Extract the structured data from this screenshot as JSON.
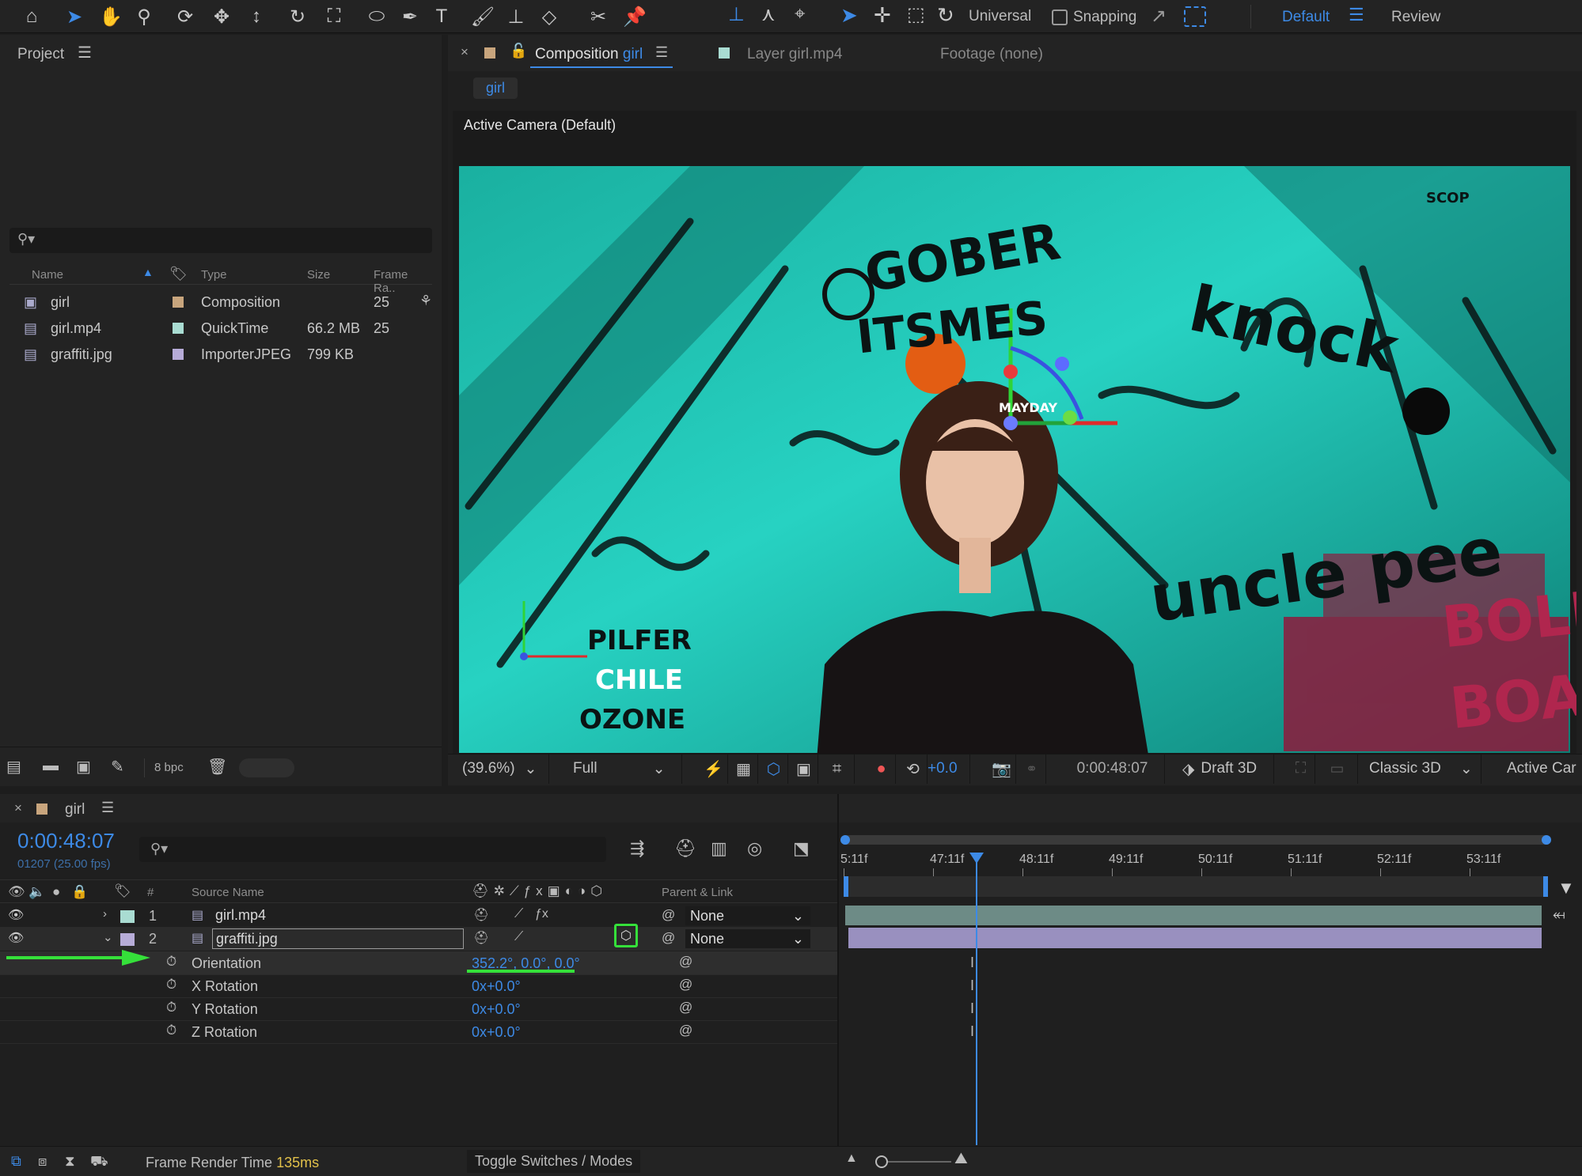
{
  "toolbar": {
    "tools": [
      {
        "name": "home-icon",
        "glyph": "⌂"
      },
      {
        "name": "selection-tool-icon",
        "glyph": "➤"
      },
      {
        "name": "hand-tool-icon",
        "glyph": "✋"
      },
      {
        "name": "zoom-tool-icon",
        "glyph": "⚲"
      },
      {
        "name": "orbit-camera-icon",
        "glyph": "⟳"
      },
      {
        "name": "pan-camera-icon",
        "glyph": "✥"
      },
      {
        "name": "dolly-camera-icon",
        "glyph": "↕"
      },
      {
        "name": "rotation-tool-icon",
        "glyph": "↻"
      },
      {
        "name": "pan-behind-icon",
        "glyph": "⛶"
      },
      {
        "name": "ellipse-tool-icon",
        "glyph": "⬭"
      },
      {
        "name": "pen-tool-icon",
        "glyph": "✒"
      },
      {
        "name": "type-tool-icon",
        "glyph": "T"
      },
      {
        "name": "brush-tool-icon",
        "glyph": "🖌"
      },
      {
        "name": "clone-stamp-icon",
        "glyph": "⊥"
      },
      {
        "name": "eraser-tool-icon",
        "glyph": "◇"
      },
      {
        "name": "roto-brush-icon",
        "glyph": "✂"
      },
      {
        "name": "puppet-pin-icon",
        "glyph": "📌"
      }
    ],
    "universal": "Universal",
    "snapping": "Snapping",
    "workspace": "Default",
    "review": "Review"
  },
  "project": {
    "title": "Project",
    "columns": {
      "name": "Name",
      "type": "Type",
      "size": "Size",
      "frame_rate": "Frame Ra.."
    },
    "items": [
      {
        "name": "girl",
        "type": "Composition",
        "size": "",
        "fps": "25",
        "color": "#c8a57d"
      },
      {
        "name": "girl.mp4",
        "type": "QuickTime",
        "size": "66.2 MB",
        "fps": "25",
        "color": "#a9dcd2"
      },
      {
        "name": "graffiti.jpg",
        "type": "ImporterJPEG",
        "size": "799 KB",
        "fps": "",
        "color": "#b7acd8"
      }
    ],
    "bpc": "8 bpc"
  },
  "viewer": {
    "tabs": [
      {
        "label": "Composition",
        "accent": "girl"
      },
      {
        "label": "Layer girl.mp4"
      },
      {
        "label": "Footage (none)"
      }
    ],
    "breadcrumb": "girl",
    "camera_label": "Active Camera (Default)",
    "zoom": "(39.6%)",
    "resolution": "Full",
    "exposure": "+0.0",
    "timecode": "0:00:48:07",
    "draft3d": "Draft 3D",
    "renderer": "Classic 3D",
    "view": "Active Car",
    "graffiti_words": [
      "GOBER",
      "ITSMES",
      "knock",
      "uncle pee",
      "BOLD",
      "BOASF",
      "PILFER",
      "CHILE",
      "OZONE",
      "MAYDAY",
      "SCOP"
    ]
  },
  "timeline": {
    "comp_name": "girl",
    "timecode": "0:00:48:07",
    "frame_info": "01207 (25.00 fps)",
    "columns": {
      "num": "#",
      "source": "Source Name",
      "parent": "Parent & Link"
    },
    "ruler": [
      "5:11f",
      "47:11f",
      "48:11f",
      "49:11f",
      "50:11f",
      "51:11f",
      "52:11f",
      "53:11f"
    ],
    "playhead_fraction": 0.19,
    "layers": [
      {
        "num": "1",
        "name": "girl.mp4",
        "parent": "None",
        "color": "#a9dcd2"
      },
      {
        "num": "2",
        "name": "graffiti.jpg",
        "parent": "None",
        "color": "#b7acd8"
      }
    ],
    "properties": [
      {
        "name": "Orientation",
        "value": "352.2°, 0.0°, 0.0°"
      },
      {
        "name": "X Rotation",
        "value": "0x+0.0°"
      },
      {
        "name": "Y Rotation",
        "value": "0x+0.0°"
      },
      {
        "name": "Z Rotation",
        "value": "0x+0.0°"
      }
    ],
    "render_label": "Frame Render Time",
    "render_value": "135ms",
    "toggle": "Toggle Switches / Modes"
  },
  "colors": {
    "accent": "#3d8ae6",
    "highlight_green": "#35e03a",
    "panel": "#232323"
  }
}
